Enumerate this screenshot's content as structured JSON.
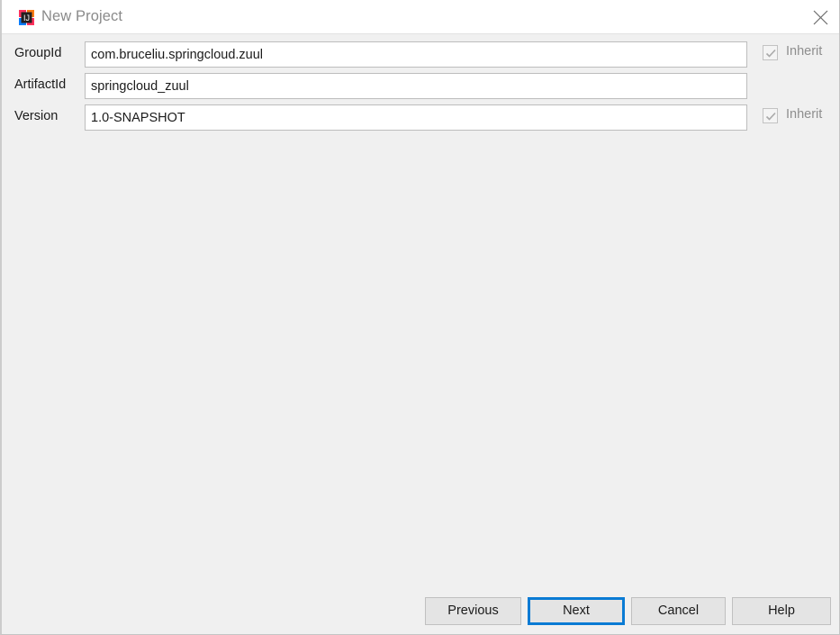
{
  "window": {
    "title": "New Project",
    "app_icon": "intellij-idea-icon",
    "close_icon": "close-icon",
    "accent_color": "#0a7bd4",
    "titlebar_bg": "#ffffff",
    "body_bg": "#f0f0f0"
  },
  "form": {
    "fields": [
      {
        "label": "GroupId",
        "value": "com.bruceliu.springcloud.zuul",
        "placeholder": "",
        "name": "groupid",
        "inherit": {
          "label": "Inherit",
          "checked": true,
          "enabled": false
        }
      },
      {
        "label": "ArtifactId",
        "value": "springcloud_zuul",
        "placeholder": "",
        "name": "artifactid",
        "inherit": null
      },
      {
        "label": "Version",
        "value": "1.0-SNAPSHOT",
        "placeholder": "",
        "name": "version",
        "inherit": {
          "label": "Inherit",
          "checked": true,
          "enabled": false
        }
      }
    ]
  },
  "buttons": {
    "previous": "Previous",
    "next": "Next",
    "cancel": "Cancel",
    "help": "Help",
    "focused": "Next"
  }
}
